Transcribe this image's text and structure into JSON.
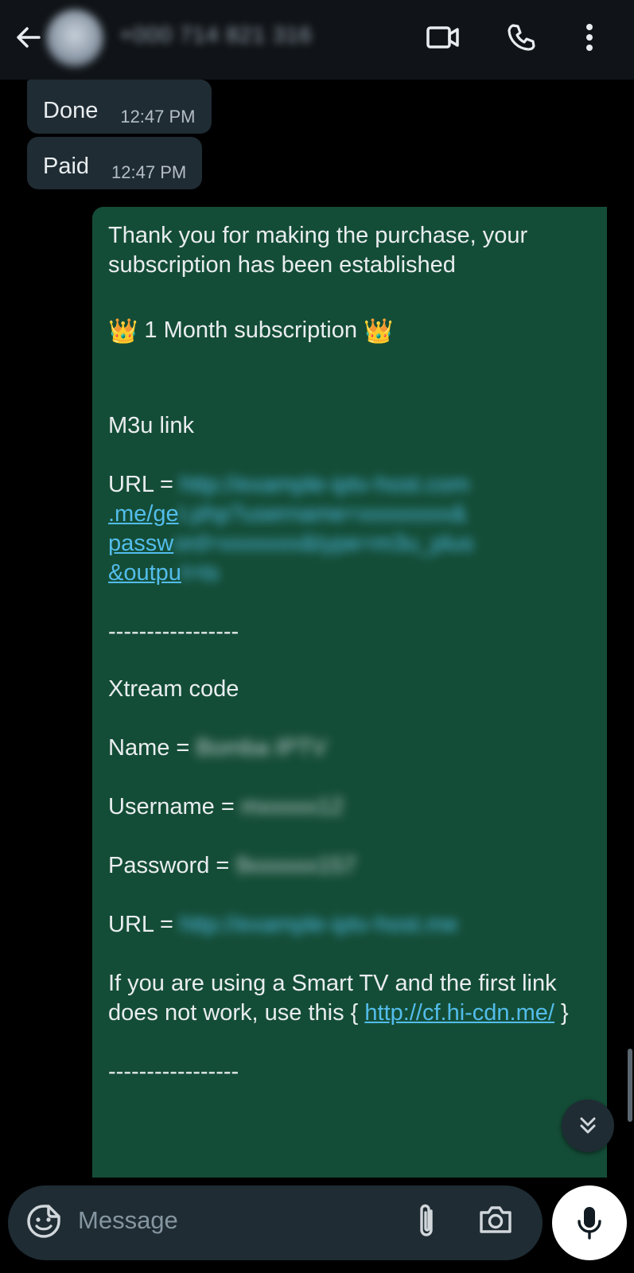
{
  "header": {
    "contact_name": "+000 714 821 316",
    "icons": [
      "back-arrow-icon",
      "avatar",
      "video-call-icon",
      "voice-call-icon",
      "more-options-icon"
    ]
  },
  "messages": {
    "incoming": [
      {
        "text": "Done",
        "time": "12:47 PM"
      },
      {
        "text": "Paid",
        "time": "12:47 PM"
      }
    ],
    "outgoing": {
      "line1": "Thank you for making the purchase, your subscription has been established",
      "crown_left": "👑",
      "plan": " 1 Month subscription ",
      "crown_right": "👑",
      "m3u_heading": "M3u link",
      "url_label": "URL = ",
      "m3u_url_part1": ".me/ge",
      "m3u_url_part2": "passw",
      "m3u_url_part3": "&outpu",
      "divider": "-----------------",
      "xtream_heading": "Xtream code",
      "name_label": "Name = ",
      "username_label": "Username = ",
      "password_label": "Password = ",
      "url2_label": "URL = ",
      "smart_tv_text": "If you are using a Smart TV and the first link does not work, use this { ",
      "smart_tv_link": "http://cf.hi-cdn.me/",
      "smart_tv_close": " }",
      "divider2": "-----------------"
    }
  },
  "composer": {
    "placeholder": "Message"
  },
  "colors": {
    "header_bg": "#101418",
    "incoming_bubble": "#1f2c34",
    "outgoing_bubble": "#144d37",
    "link": "#53bdeb"
  }
}
